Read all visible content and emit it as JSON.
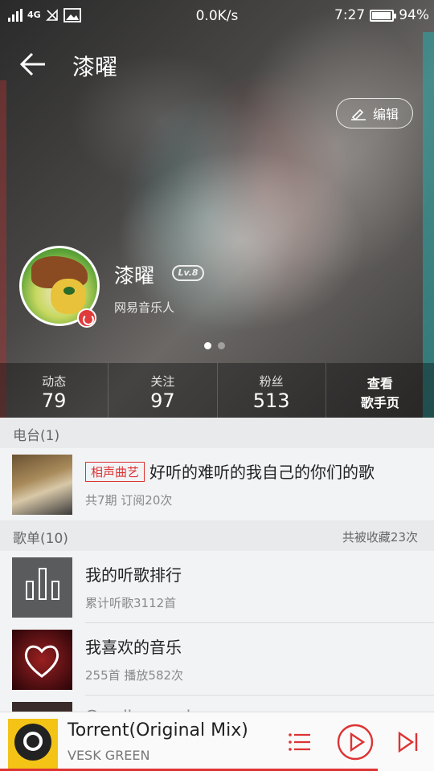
{
  "status_bar": {
    "network": "4G",
    "speed": "0.0K/s",
    "time": "7:27",
    "battery": "94%",
    "battery_level": 0.94
  },
  "header": {
    "title": "漆曜",
    "edit_label": "编辑"
  },
  "profile": {
    "name": "漆曜",
    "level": "Lv.8",
    "tag": "网易音乐人",
    "carousel_pages": 2,
    "carousel_active": 1
  },
  "stats": [
    {
      "label": "动态",
      "value": "79"
    },
    {
      "label": "关注",
      "value": "97"
    },
    {
      "label": "粉丝",
      "value": "513"
    },
    {
      "label": "查看",
      "value": "歌手页"
    }
  ],
  "radio_section": {
    "title": "电台(1)",
    "items": [
      {
        "tag": "相声曲艺",
        "title": "好听的难听的我自己的你们的歌",
        "meta": "共7期 订阅20次"
      }
    ]
  },
  "playlist_section": {
    "title": "歌单(10)",
    "right": "共被收藏23次",
    "items": [
      {
        "title": "我的听歌排行",
        "meta": "累计听歌3112首"
      },
      {
        "title": "我喜欢的音乐",
        "meta": "255首 播放582次"
      },
      {
        "title": "Goodbye sadness",
        "meta": ""
      }
    ]
  },
  "player": {
    "song": "Torrent(Original Mix)",
    "artist": "VESK GREEN",
    "progress": 0.87
  },
  "icons": {
    "back": "arrow-left-icon",
    "edit": "pencil-icon",
    "playlist": "list-icon",
    "play": "play-circle-icon",
    "next": "skip-next-icon"
  },
  "colors": {
    "accent": "#d33333",
    "badge": "#e03a3a"
  }
}
